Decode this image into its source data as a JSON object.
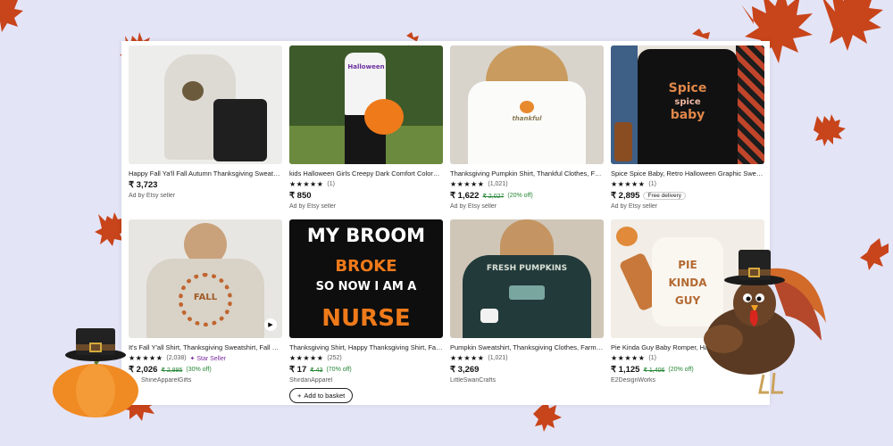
{
  "listings": [
    {
      "title": "Happy Fall Ya'll Fall Autumn Thanksgiving Sweatshirt",
      "price": "₹ 3,723",
      "ad": "Ad by Etsy seller"
    },
    {
      "title": "kids Halloween Girls Creepy Dark Comfort Colors Tee",
      "stars": "★★★★★",
      "reviews": "(1)",
      "price": "₹ 850",
      "ad": "Ad by Etsy seller",
      "shirt_text": "Halloween"
    },
    {
      "title": "Thanksgiving Pumpkin Shirt, Thankful Clothes, Fall Tee",
      "stars": "★★★★★",
      "reviews": "(1,021)",
      "price": "₹ 1,622",
      "original": "₹ 2,027",
      "discount": "(20% off)",
      "ad": "Ad by Etsy seller",
      "shirt_text": "thankful"
    },
    {
      "title": "Spice Spice Baby, Retro Halloween Graphic Sweatshirt",
      "stars": "★★★★★",
      "reviews": "(1)",
      "price": "₹ 2,895",
      "badge": "Free delivery",
      "ad": "Ad by Etsy seller",
      "shirt_text_1": "Spice",
      "shirt_text_2": "spice",
      "shirt_text_3": "baby"
    },
    {
      "title": "It's Fall Y'all Shirt, Thanksgiving Sweatshirt, Fall Shirt",
      "stars": "★★★★★",
      "reviews": "(2,038)",
      "star_seller": "Star Seller",
      "price": "₹ 2,026",
      "original": "₹ 2,895",
      "discount": "(30% off)",
      "shop": "ShineApparelGifts",
      "shirt_text": "FALL"
    },
    {
      "title": "Thanksgiving Shirt, Happy Thanksgiving Shirt, Fall Shirt",
      "stars": "★★★★★",
      "reviews": "(252)",
      "price": "₹ 17",
      "original": "₹ 43",
      "discount": "(70% off)",
      "shop": "ShirdanApparel",
      "button": "Add to basket",
      "shirt_line_1": "MY BROOM",
      "shirt_line_2": "BROKE",
      "shirt_line_3": "SO NOW I AM A",
      "shirt_line_4": "NURSE"
    },
    {
      "title": "Pumpkin Sweatshirt, Thanksgiving Clothes, Farm Tee",
      "stars": "★★★★★",
      "reviews": "(1,021)",
      "price": "₹ 3,269",
      "shop": "LittleSwanCrafts",
      "shirt_text": "FRESH PUMPKINS"
    },
    {
      "title": "Pie Kinda Guy Baby Romper, Halloween Romper",
      "stars": "★★★★★",
      "reviews": "(1)",
      "price": "₹ 1,125",
      "original": "₹ 1,406",
      "discount": "(20% off)",
      "shop": "E2DesignWorks",
      "shirt_line_1": "PIE",
      "shirt_line_2": "KINDA",
      "shirt_line_3": "GUY"
    }
  ],
  "colors": {
    "background": "#e4e4f7",
    "leaf": "#c8441a",
    "discount": "#258635",
    "star_seller": "#7a2d9e"
  }
}
